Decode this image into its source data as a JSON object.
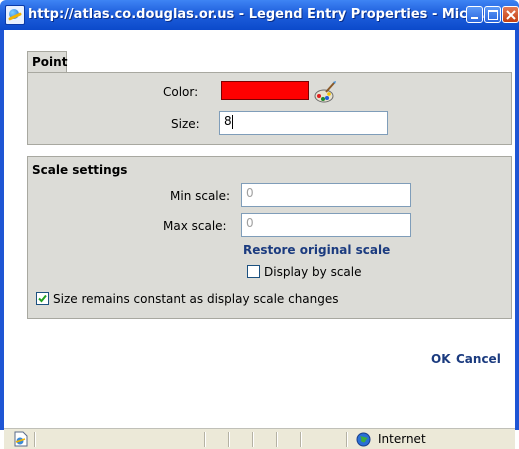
{
  "window": {
    "title": "http://atlas.co.douglas.or.us - Legend Entry Properties - Micro..."
  },
  "point": {
    "section_label": "Point",
    "color_label": "Color:",
    "color_value": "#ff0000",
    "size_label": "Size:",
    "size_value": "8"
  },
  "scale": {
    "section_label": "Scale settings",
    "min_label": "Min scale:",
    "min_value": "0",
    "max_label": "Max scale:",
    "max_value": "0",
    "restore_link": "Restore original scale",
    "display_by_scale_label": "Display by scale",
    "display_by_scale_checked": false,
    "constant_size_label": "Size remains constant as display scale changes",
    "constant_size_checked": true
  },
  "actions": {
    "ok_label": "OK",
    "cancel_label": "Cancel"
  },
  "statusbar": {
    "zone_label": "Internet"
  },
  "icons": {
    "title": "ie-page-icon",
    "palette": "paint-palette-icon",
    "zone": "globe-icon",
    "status_page": "page-icon"
  },
  "colors": {
    "titlebar": "#0b4acb",
    "panel": "#dcdcd7",
    "link": "#1b3b7f"
  }
}
